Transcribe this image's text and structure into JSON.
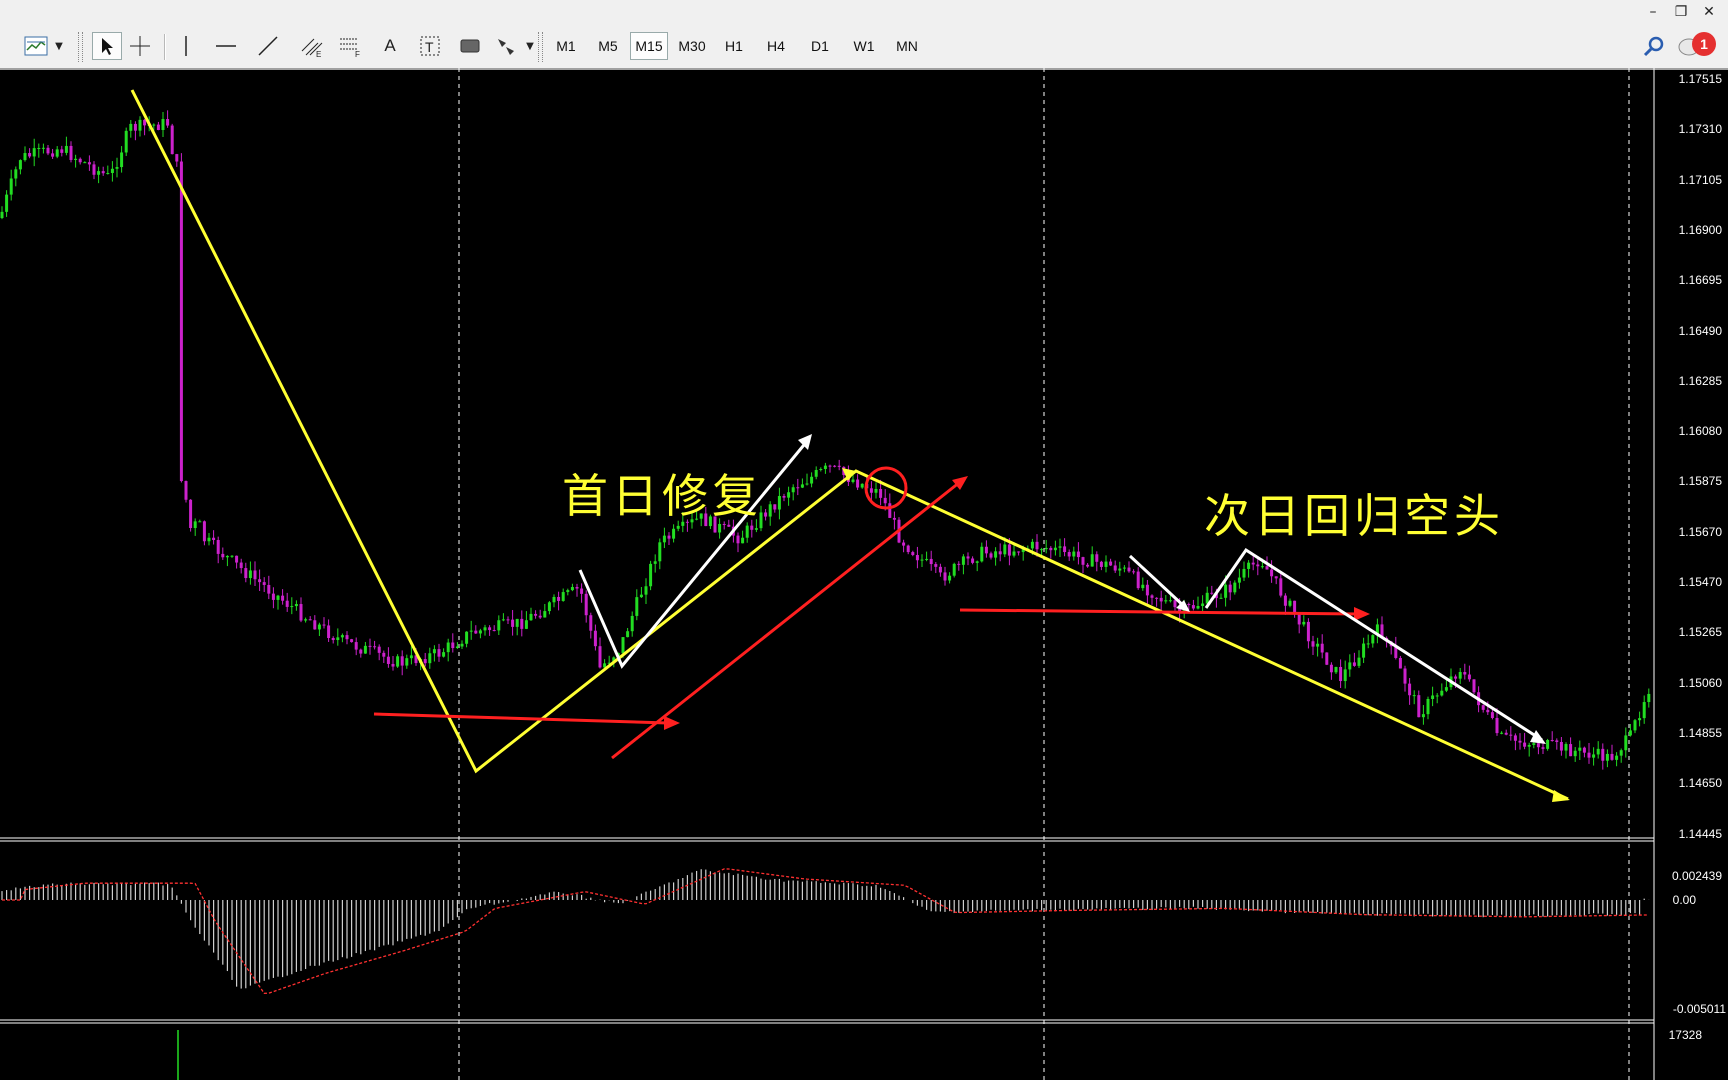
{
  "window_controls": {
    "minimize": "–",
    "restore": "❐",
    "close": "✕"
  },
  "toolbar": {
    "text_tool": "A",
    "timeframes": [
      "M1",
      "M5",
      "M15",
      "M30",
      "H1",
      "H4",
      "D1",
      "W1",
      "MN"
    ],
    "active_timeframe": "M15",
    "notification_count": "1"
  },
  "price_axis": [
    "1.17515",
    "1.17310",
    "1.17105",
    "1.16900",
    "1.16695",
    "1.16490",
    "1.16285",
    "1.16080",
    "1.15875",
    "1.15670",
    "1.15470",
    "1.15265",
    "1.15060",
    "1.14855",
    "1.14650",
    "1.14445"
  ],
  "macd_axis": {
    "top": "0.002439",
    "zero": "0.00",
    "bottom": "-0.005011"
  },
  "volume_axis": {
    "top": "17328"
  },
  "annotations": {
    "first_day": "首日修复",
    "next_day": "次日回归空头"
  },
  "colors": {
    "bull": "#22dd22",
    "bear": "#cc22cc",
    "yellow": "#ffff33",
    "red": "#ff2020",
    "white": "#ffffff",
    "macd_signal": "#ff3030"
  }
}
